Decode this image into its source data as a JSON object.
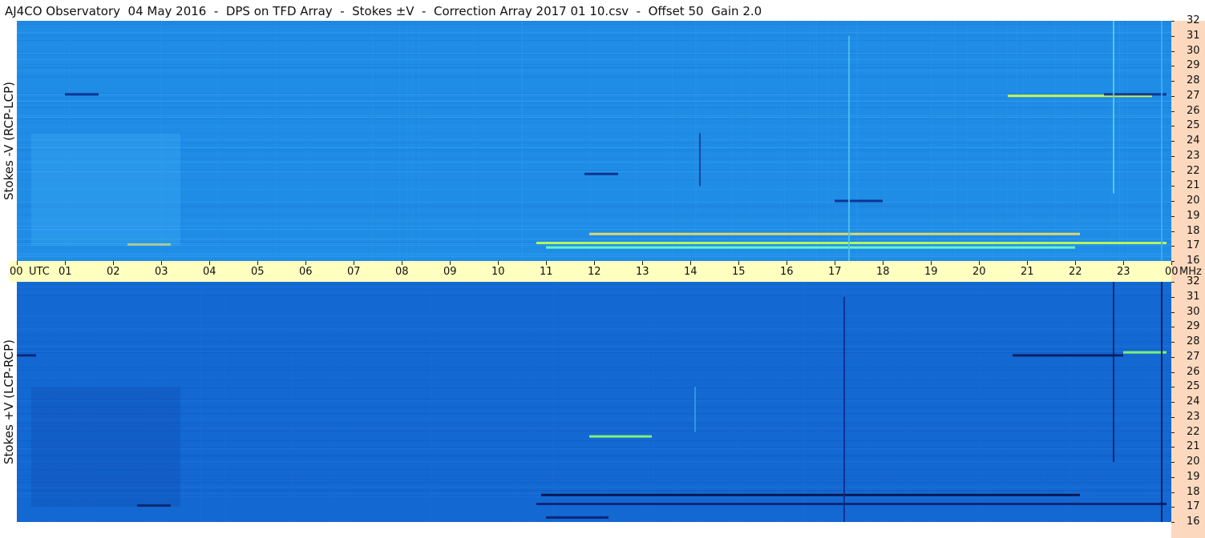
{
  "chart_data": [
    {
      "type": "heatmap",
      "title": "AJ4CO Observatory  04 May 2016  -  DPS on TFD Array  -  Stokes ±V  -  Correction Array 2017 01 10.csv  -  Offset 50  Gain 2.0",
      "ylabel": "Stokes -V (RCP-LCP)",
      "xlabel": "",
      "x_ticks": [
        "00",
        "01",
        "02",
        "03",
        "04",
        "05",
        "06",
        "07",
        "08",
        "09",
        "10",
        "11",
        "12",
        "13",
        "14",
        "15",
        "16",
        "17",
        "18",
        "19",
        "20",
        "21",
        "22",
        "23",
        "00"
      ],
      "x_unit": "UTC",
      "y_ticks": [
        16,
        17,
        18,
        19,
        20,
        21,
        22,
        23,
        24,
        25,
        26,
        27,
        28,
        29,
        30,
        31,
        32
      ],
      "y_unit": "MHz",
      "xlim": [
        0,
        24
      ],
      "ylim": [
        16,
        32
      ],
      "base_color": "#1f8ce6",
      "features": [
        {
          "kind": "band",
          "x": [
            10.8,
            23.9
          ],
          "y": 17.2,
          "color": "#c8ff50"
        },
        {
          "kind": "band",
          "x": [
            11.9,
            22.1
          ],
          "y": 17.8,
          "color": "#f0e060"
        },
        {
          "kind": "band",
          "x": [
            11.0,
            22.0
          ],
          "y": 16.9,
          "color": "#70ffc0"
        },
        {
          "kind": "band",
          "x": [
            20.6,
            23.6
          ],
          "y": 27.0,
          "color": "#d6ff40"
        },
        {
          "kind": "band",
          "x": [
            22.6,
            23.9
          ],
          "y": 27.1,
          "color": "#0b2f8c"
        },
        {
          "kind": "band",
          "x": [
            1.0,
            1.7
          ],
          "y": 27.1,
          "color": "#0a2a88"
        },
        {
          "kind": "band",
          "x": [
            11.8,
            12.5
          ],
          "y": 21.8,
          "color": "#0a2a88"
        },
        {
          "kind": "band",
          "x": [
            17.0,
            18.0
          ],
          "y": 20.0,
          "color": "#0a2a88"
        },
        {
          "kind": "band",
          "x": [
            2.3,
            3.2
          ],
          "y": 17.1,
          "color": "#f0e060"
        },
        {
          "kind": "vline",
          "x": 22.8,
          "y": [
            20.5,
            32
          ],
          "color": "#5ad2f0"
        },
        {
          "kind": "vline",
          "x": 17.3,
          "y": [
            16,
            31
          ],
          "color": "#4ac6ea"
        },
        {
          "kind": "vline",
          "x": 14.2,
          "y": [
            21,
            24.5
          ],
          "color": "#0d3a98"
        },
        {
          "kind": "vline",
          "x": 23.8,
          "y": [
            16,
            32
          ],
          "color": "#3fb0ee"
        },
        {
          "kind": "patch",
          "x": [
            0.3,
            3.4
          ],
          "y": [
            17,
            24.5
          ],
          "color": "#3eaef0"
        }
      ]
    },
    {
      "type": "heatmap",
      "ylabel": "Stokes +V (LCP-RCP)",
      "xlabel": "",
      "x_ticks": [
        "00",
        "01",
        "02",
        "03",
        "04",
        "05",
        "06",
        "07",
        "08",
        "09",
        "10",
        "11",
        "12",
        "13",
        "14",
        "15",
        "16",
        "17",
        "18",
        "19",
        "20",
        "21",
        "22",
        "23",
        "00"
      ],
      "x_unit": "UTC",
      "y_ticks": [
        16,
        17,
        18,
        19,
        20,
        21,
        22,
        23,
        24,
        25,
        26,
        27,
        28,
        29,
        30,
        31,
        32
      ],
      "y_unit": "MHz",
      "xlim": [
        0,
        24
      ],
      "ylim": [
        16,
        32
      ],
      "base_color": "#1468d2",
      "features": [
        {
          "kind": "band",
          "x": [
            10.9,
            22.1
          ],
          "y": 17.8,
          "color": "#050d40"
        },
        {
          "kind": "band",
          "x": [
            10.8,
            23.9
          ],
          "y": 17.2,
          "color": "#0a2070"
        },
        {
          "kind": "band",
          "x": [
            20.7,
            23.0
          ],
          "y": 27.1,
          "color": "#08185e"
        },
        {
          "kind": "band",
          "x": [
            23.0,
            23.9
          ],
          "y": 27.3,
          "color": "#8aff70"
        },
        {
          "kind": "band",
          "x": [
            11.9,
            13.2
          ],
          "y": 21.7,
          "color": "#8aff70"
        },
        {
          "kind": "band",
          "x": [
            0.0,
            0.4
          ],
          "y": 27.1,
          "color": "#0a2070"
        },
        {
          "kind": "band",
          "x": [
            2.5,
            3.2
          ],
          "y": 17.1,
          "color": "#050d40"
        },
        {
          "kind": "band",
          "x": [
            11.0,
            12.3
          ],
          "y": 16.3,
          "color": "#0a2070"
        },
        {
          "kind": "vline",
          "x": 22.8,
          "y": [
            20,
            32
          ],
          "color": "#0a1e66"
        },
        {
          "kind": "vline",
          "x": 23.8,
          "y": [
            16,
            32
          ],
          "color": "#061650"
        },
        {
          "kind": "vline",
          "x": 17.2,
          "y": [
            16,
            31
          ],
          "color": "#0d2c85"
        },
        {
          "kind": "vline",
          "x": 14.1,
          "y": [
            22,
            25
          ],
          "color": "#2ea2e6"
        },
        {
          "kind": "patch",
          "x": [
            0.3,
            3.4
          ],
          "y": [
            17,
            25
          ],
          "color": "#0f4cb4"
        }
      ]
    }
  ]
}
